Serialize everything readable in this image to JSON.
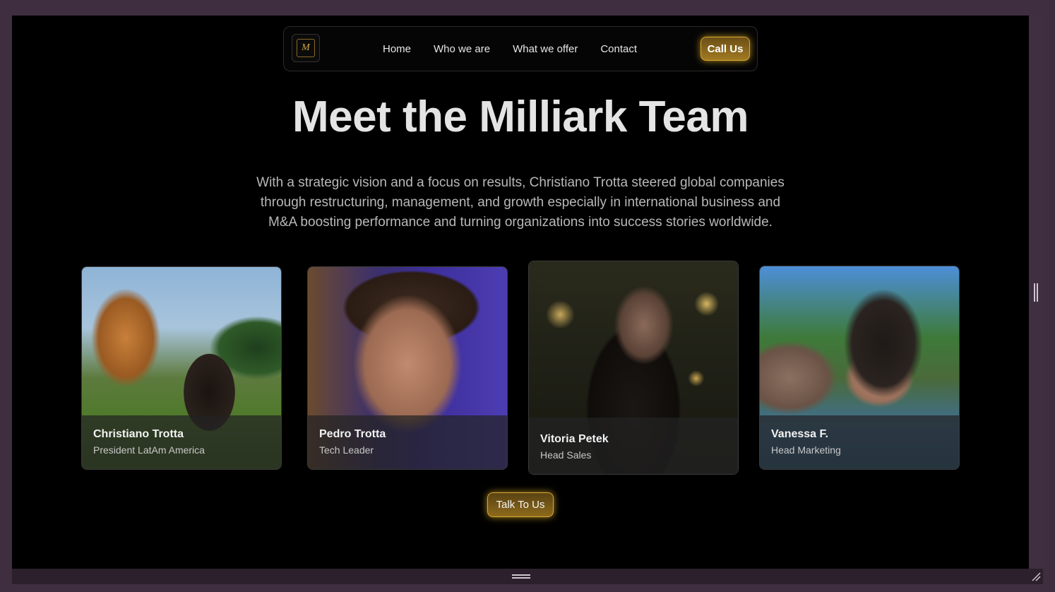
{
  "nav": {
    "logo_letter": "M",
    "links": [
      "Home",
      "Who we are",
      "What we offer",
      "Contact"
    ],
    "cta_label": "Call Us"
  },
  "hero": {
    "title": "Meet the Milliark Team",
    "intro": "With a strategic vision and a focus on results, Christiano Trotta steered global companies through restructuring, management, and growth especially in international business and M&A boosting performance and turning organizations into success stories worldwide."
  },
  "team": [
    {
      "name": "Christiano Trotta",
      "role": "President LatAm America"
    },
    {
      "name": "Pedro Trotta",
      "role": "Tech Leader"
    },
    {
      "name": "Vitoria Petek",
      "role": "Head Sales"
    },
    {
      "name": "Vanessa F.",
      "role": "Head Marketing"
    }
  ],
  "cta": {
    "label": "Talk To Us"
  },
  "colors": {
    "accent_gold": "#d9a934",
    "background": "#000000",
    "window_frame": "#3f2e40"
  }
}
